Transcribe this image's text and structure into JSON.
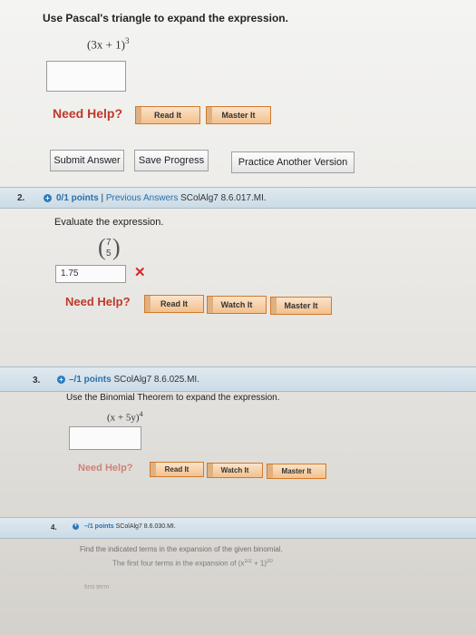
{
  "q1": {
    "instruction": "Use Pascal's triangle to expand the expression.",
    "expression": "(3x + 1)",
    "exponent": "3",
    "need_help": "Need Help?",
    "read_it": "Read It",
    "master_it": "Master It",
    "submit": "Submit Answer",
    "save": "Save Progress",
    "practice": "Practice Another Version"
  },
  "q2": {
    "number": "2.",
    "points": "0/1 points",
    "sep": "|",
    "previous": "Previous Answers",
    "code": "SColAlg7 8.6.017.MI.",
    "instruction": "Evaluate the expression.",
    "binom_top": "7",
    "binom_bottom": "5",
    "answer": "1.75",
    "wrong_mark": "✕",
    "need_help": "Need Help?",
    "read_it": "Read It",
    "watch_it": "Watch It",
    "master_it": "Master It"
  },
  "q3": {
    "number": "3.",
    "points": "–/1 points",
    "code": "SColAlg7 8.6.025.MI.",
    "instruction": "Use the Binomial Theorem to expand the expression.",
    "expression": "(x + 5y)",
    "exponent": "4",
    "need_help": "Need Help?",
    "read_it": "Read It",
    "watch_it": "Watch It",
    "master_it": "Master It"
  },
  "q4": {
    "number": "4.",
    "points": "–/1 points",
    "code": "SColAlg7 8.6.030.MI.",
    "instruction": "Find the indicated terms in the expansion of the given binomial.",
    "line2": "The first four terms in the expansion of",
    "expr": "(x",
    "exp_inner": "1/2",
    "expr_tail": "+ 1)",
    "exponent": "20",
    "line3": "first term"
  },
  "colors": {
    "need_help": "#c0392b",
    "header_bg": "#d3e1ea",
    "link": "#2b6fa8",
    "wrong": "#d02a2a"
  }
}
